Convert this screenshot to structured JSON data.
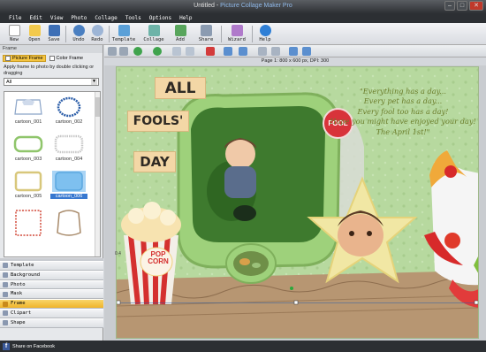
{
  "window": {
    "doc_title": "Untitled",
    "separator": " - ",
    "app_title": "Picture Collage Maker Pro"
  },
  "menu": [
    "File",
    "Edit",
    "View",
    "Photo",
    "Collage",
    "Tools",
    "Options",
    "Help"
  ],
  "toolbar": {
    "new": "New",
    "open": "Open",
    "save": "Save",
    "undo": "Undo",
    "redo": "Redo",
    "template": "Template",
    "collage": "Collage",
    "add": "Add",
    "share": "Share",
    "wizard": "Wizard",
    "help": "Help"
  },
  "left_panel": {
    "header": "Frame",
    "tab_picture": "Picture Frame",
    "tab_color": "Color Frame",
    "hint": "Apply frame to photo by double clicking or dragging",
    "category_value": "All",
    "thumbnails": [
      "cartoon_001",
      "cartoon_002",
      "cartoon_003",
      "cartoon_004",
      "cartoon_005",
      "cartoon_006",
      "",
      ""
    ],
    "selected_thumbnail": "cartoon_006"
  },
  "side_tabs": [
    "Template",
    "Background",
    "Photo",
    "Mask",
    "Frame",
    "Clipart",
    "Shape"
  ],
  "active_side_tab": "Frame",
  "page_info": "Page 1: 800 x 600 px, DPI: 300",
  "ruler_mark": "0.4",
  "canvas": {
    "words": [
      "ALL",
      "FOOLS'",
      "DAY"
    ],
    "badge": "FOOL",
    "quote_lines": [
      "\"Everything has a day...",
      "Every pet has a day...",
      "Every fool too has a day!",
      "Hope you might have enjoyed your day!",
      "The April 1st!\""
    ],
    "popcorn_text": [
      "POP",
      "CORN"
    ]
  },
  "status": {
    "share_label": "Share on Facebook"
  },
  "colors": {
    "canvas_bg": "#b7d99f",
    "active_tab": "#f0b429",
    "selection": "#3878d0",
    "quote_text": "#6b7d2b",
    "badge": "#d8333a"
  }
}
